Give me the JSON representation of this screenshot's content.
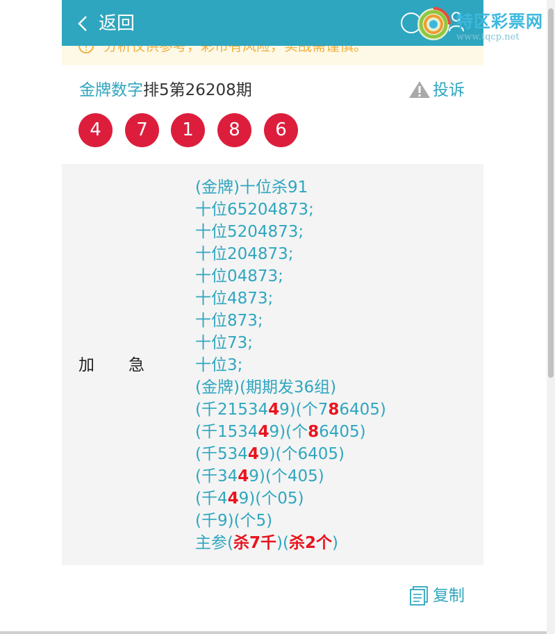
{
  "colors": {
    "brand": "#2fa6bf",
    "ball": "#dc1e3c",
    "highlight": "#e8141f",
    "notice": "#f0b040"
  },
  "header": {
    "back_label": "返回",
    "back_icon": "chevron-left-icon",
    "search_icon": "search-icon",
    "user_icon": "user-icon",
    "logo_title": "特区彩票网",
    "logo_url": "www.tqcp.net"
  },
  "notice": {
    "icon": "info-circle-icon",
    "icon_glyph": "!",
    "text": "分析仅供参考，彩市有风险，实战需谨慎。"
  },
  "post": {
    "author": "金牌数字",
    "title_rest": "排5第26208期",
    "report_label": "投诉",
    "report_icon": "warning-icon",
    "balls": [
      "4",
      "7",
      "1",
      "8",
      "6"
    ]
  },
  "content": {
    "label_1": "加",
    "label_2": "急",
    "lines": [
      [
        {
          "t": "(金牌)十位杀91"
        }
      ],
      [
        {
          "t": "十位65204873;"
        }
      ],
      [
        {
          "t": "十位5204873;"
        }
      ],
      [
        {
          "t": "十位204873;"
        }
      ],
      [
        {
          "t": "十位04873;"
        }
      ],
      [
        {
          "t": "十位4873;"
        }
      ],
      [
        {
          "t": "十位873;"
        }
      ],
      [
        {
          "t": "十位73;"
        }
      ],
      [
        {
          "t": "十位3;"
        }
      ],
      [
        {
          "t": "(金牌)(期期发36组)"
        }
      ],
      [
        {
          "t": "(千21534"
        },
        {
          "t": "4",
          "h": true
        },
        {
          "t": "9)(个7"
        },
        {
          "t": "8",
          "h": true
        },
        {
          "t": "6405)"
        }
      ],
      [
        {
          "t": "(千1534"
        },
        {
          "t": "4",
          "h": true
        },
        {
          "t": "9)(个"
        },
        {
          "t": "8",
          "h": true
        },
        {
          "t": "6405)"
        }
      ],
      [
        {
          "t": "(千534"
        },
        {
          "t": "4",
          "h": true
        },
        {
          "t": "9)(个6405)"
        }
      ],
      [
        {
          "t": "(千34"
        },
        {
          "t": "4",
          "h": true
        },
        {
          "t": "9)(个405)"
        }
      ],
      [
        {
          "t": "(千4"
        },
        {
          "t": "4",
          "h": true
        },
        {
          "t": "9)(个05)"
        }
      ],
      [
        {
          "t": "(千9)(个5)"
        }
      ],
      [
        {
          "t": "主参("
        },
        {
          "t": "杀7千",
          "h": true
        },
        {
          "t": ")("
        },
        {
          "t": "杀2个",
          "h": true
        },
        {
          "t": ")"
        }
      ]
    ]
  },
  "footer": {
    "copy_label": "复制",
    "copy_icon": "copy-icon"
  }
}
